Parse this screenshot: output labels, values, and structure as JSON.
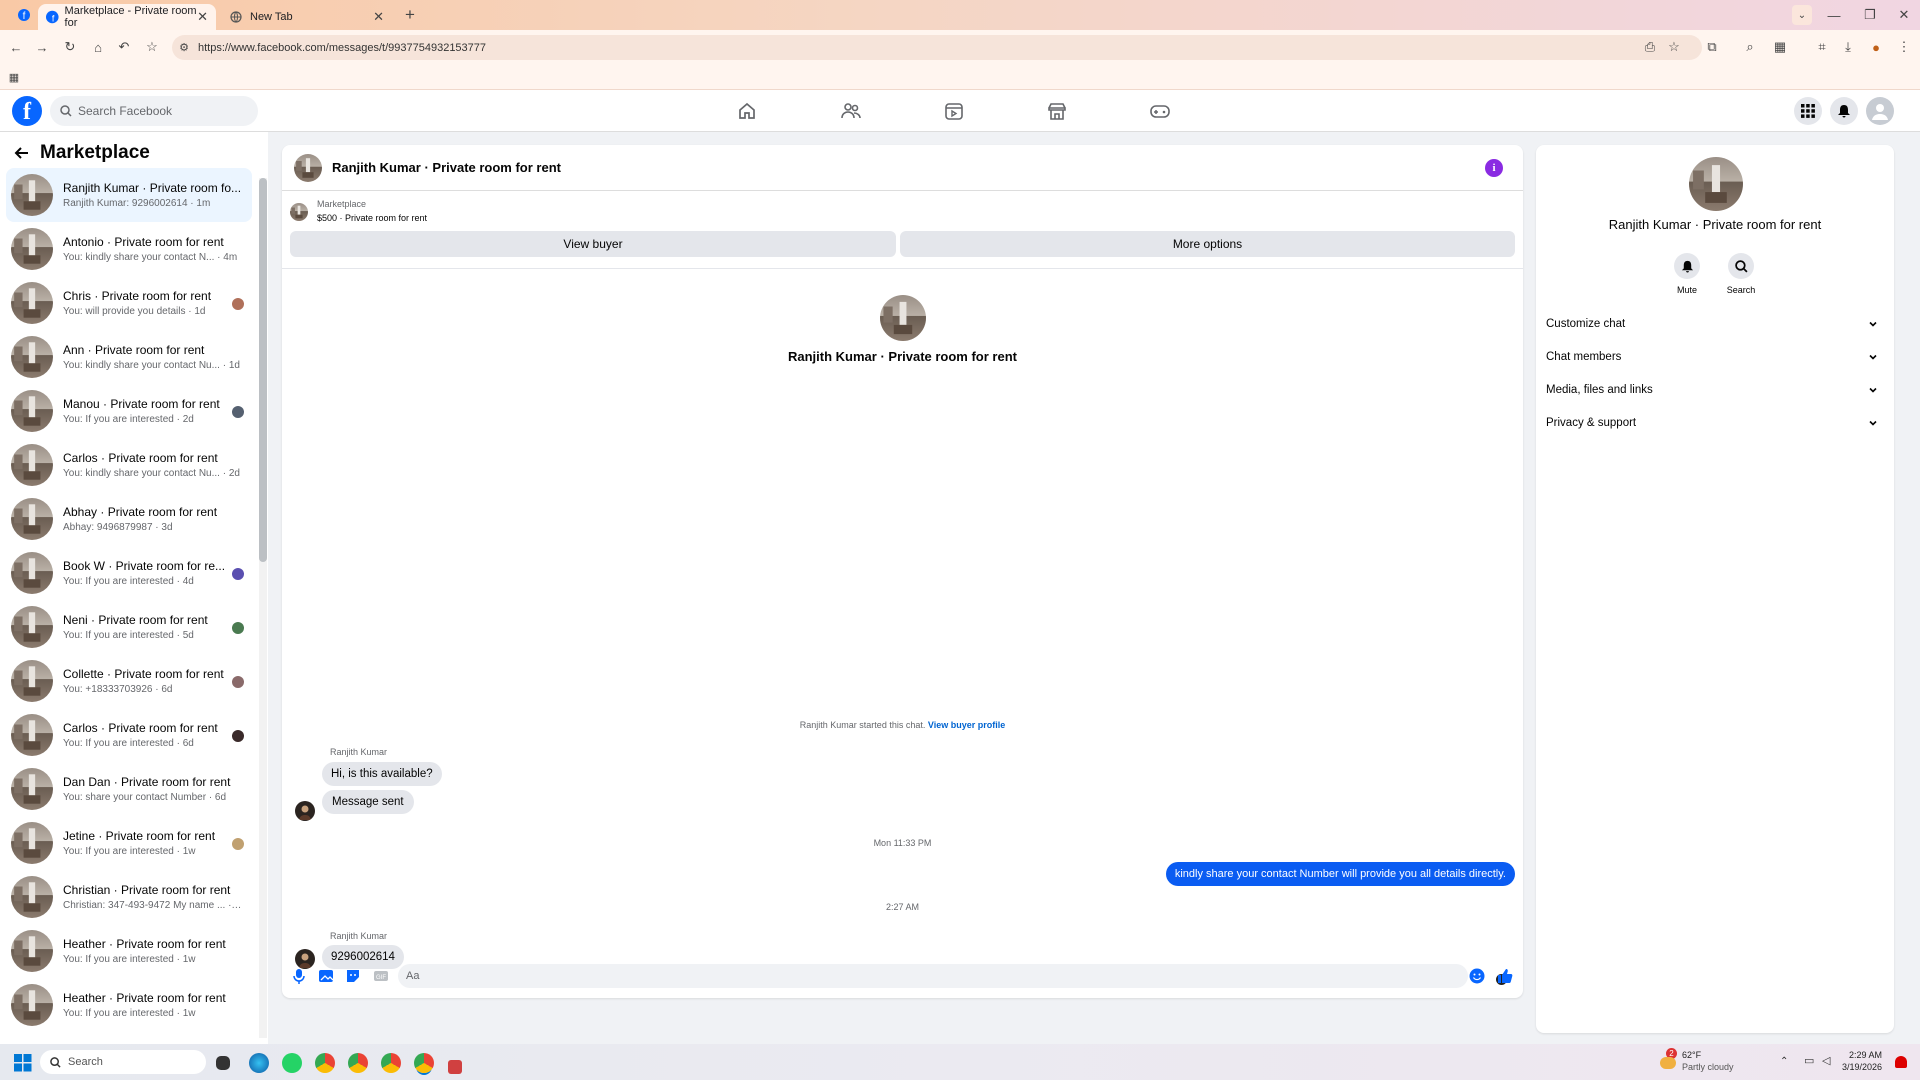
{
  "browser": {
    "tabs": [
      {
        "title": "Marketplace - Private room for",
        "active": true
      },
      {
        "title": "New Tab",
        "active": false
      }
    ],
    "url": "https://www.facebook.com/messages/t/9937754932153777"
  },
  "fb": {
    "search_placeholder": "Search Facebook"
  },
  "sidebar": {
    "title": "Marketplace",
    "conversations": [
      {
        "name": "Ranjith Kumar · Private room fo...",
        "sub": "Ranjith Kumar: 9296002614 · 1m",
        "active": true,
        "dot": ""
      },
      {
        "name": "Antonio · Private room for rent",
        "sub": "You: kindly share your contact N... · 4m",
        "dot": ""
      },
      {
        "name": "Chris · Private room for rent",
        "sub": "You: will provide you details · 1d",
        "dot": "#b0705a"
      },
      {
        "name": "Ann · Private room for rent",
        "sub": "You: kindly share your contact Nu... · 1d",
        "dot": ""
      },
      {
        "name": "Manou · Private room for rent",
        "sub": "You: If you are interested · 2d",
        "dot": "#556070"
      },
      {
        "name": "Carlos · Private room for rent",
        "sub": "You: kindly share your contact Nu... · 2d",
        "dot": ""
      },
      {
        "name": "Abhay · Private room for rent",
        "sub": "Abhay: 9496879987 · 3d",
        "dot": ""
      },
      {
        "name": "Book W · Private room for re...",
        "sub": "You: If you are interested · 4d",
        "dot": "#5a4fb0"
      },
      {
        "name": "Neni · Private room for rent",
        "sub": "You: If you are interested · 5d",
        "dot": "#4a7a50"
      },
      {
        "name": "Collette · Private room for rent",
        "sub": "You: +18333703926 · 6d",
        "dot": "#8a6a6a"
      },
      {
        "name": "Carlos · Private room for rent",
        "sub": "You: If you are interested · 6d",
        "dot": "#3a2a2a"
      },
      {
        "name": "Dan Dan · Private room for rent",
        "sub": "You: share your contact Number · 6d",
        "dot": ""
      },
      {
        "name": "Jetine · Private room for rent",
        "sub": "You: If you are interested · 1w",
        "dot": "#c0a070"
      },
      {
        "name": "Christian · Private room for rent",
        "sub": "Christian: 347-493-9472 My name ... · 1w",
        "dot": ""
      },
      {
        "name": "Heather · Private room for rent",
        "sub": "You: If you are interested · 1w",
        "dot": ""
      },
      {
        "name": "Heather · Private room for rent",
        "sub": "You: If you are interested · 1w",
        "dot": ""
      }
    ]
  },
  "chat": {
    "title": "Ranjith Kumar · Private room for rent",
    "listing_source": "Marketplace",
    "listing_price": "$500 · Private room for rent",
    "view_buyer": "View buyer",
    "more_options": "More options",
    "center_name": "Ranjith Kumar · Private room for rent",
    "started_text": "Ranjith Kumar started this chat.",
    "view_buyer_profile": "View buyer profile",
    "sender1": "Ranjith Kumar",
    "msg1": "Hi, is this available?",
    "msg2": "Message sent",
    "stamp1": "Mon 11:33 PM",
    "out_msg": "kindly share your contact Number will provide you all details directly.",
    "stamp2": "2:27 AM",
    "sender2": "Ranjith Kumar",
    "msg3": "9296002614",
    "composer_placeholder": "Aa"
  },
  "right_panel": {
    "name": "Ranjith Kumar · Private room for rent",
    "mute": "Mute",
    "search": "Search",
    "rows": [
      "Customize chat",
      "Chat members",
      "Media, files and links",
      "Privacy & support"
    ]
  },
  "taskbar": {
    "search": "Search",
    "temp": "62°F",
    "weather": "Partly cloudy",
    "weather_badge": "2",
    "time": "2:29 AM",
    "date": "3/19/2026"
  },
  "colors": {
    "accent": "#0866ff",
    "out_bubble": "#0a5cf2",
    "info": "#8a2be2"
  }
}
